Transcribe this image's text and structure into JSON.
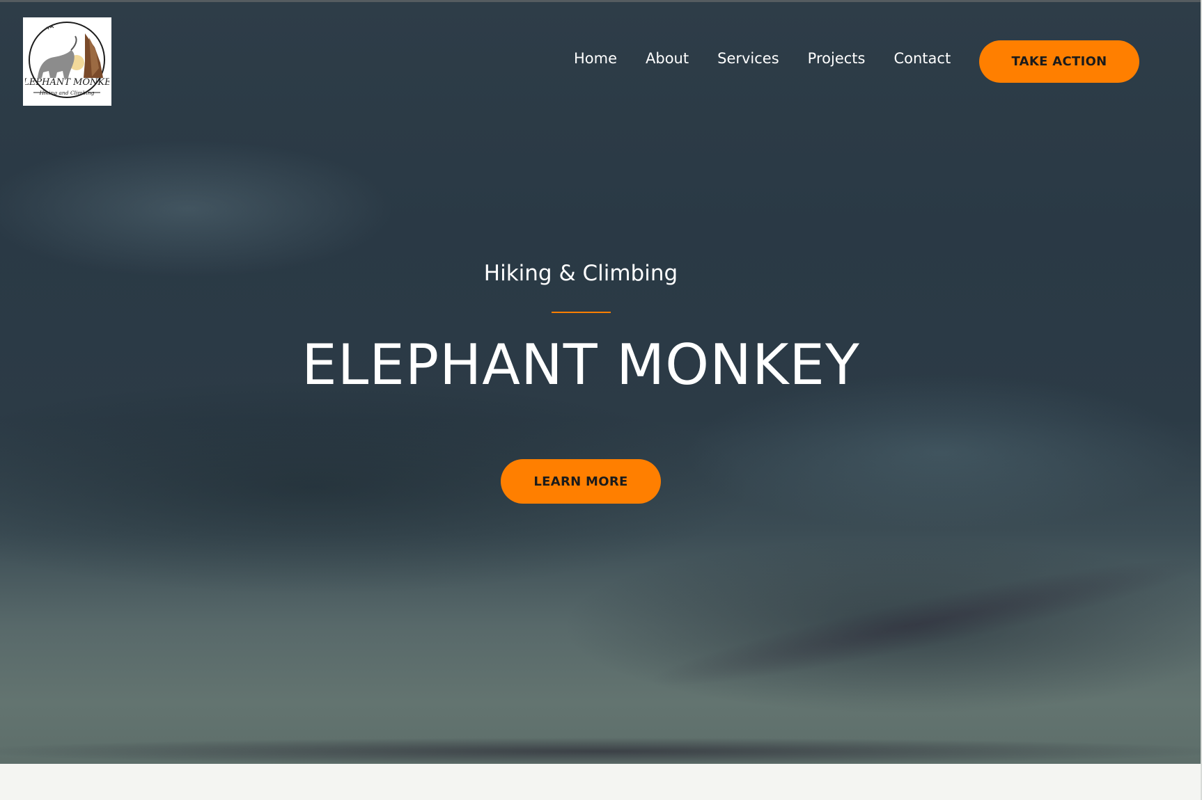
{
  "header": {
    "logo": {
      "text_line1": "ELEPHANT MONKEY",
      "text_line2": "Hiking and Climbing"
    },
    "nav": [
      {
        "label": "Home"
      },
      {
        "label": "About"
      },
      {
        "label": "Services"
      },
      {
        "label": "Projects"
      },
      {
        "label": "Contact"
      }
    ],
    "cta_label": "TAKE ACTION"
  },
  "hero": {
    "eyebrow": "Hiking & Climbing",
    "title": "ELEPHANT MONKEY",
    "cta_label": "LEARN MORE"
  },
  "colors": {
    "accent": "#ff7f00",
    "hero_text": "#ffffff",
    "button_text": "#1b1b1b",
    "page_background": "#f4f5f2"
  }
}
